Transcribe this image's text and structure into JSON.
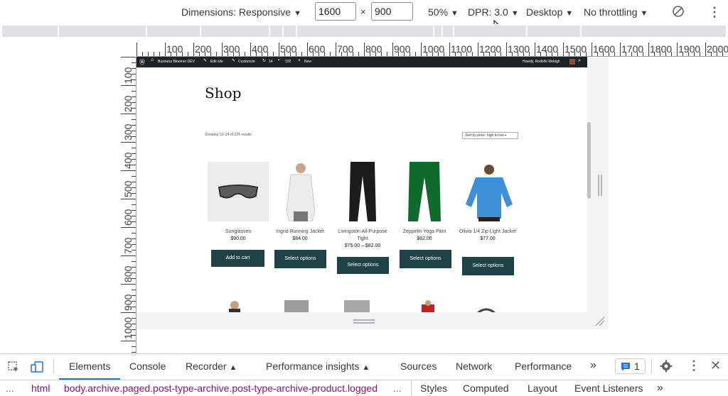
{
  "toolbar": {
    "dimensions_label": "Dimensions: Responsive",
    "width_value": "1600",
    "times": "×",
    "height_value": "900",
    "zoom": "50%",
    "dpr": "DPR: 3.0",
    "device_type": "Desktop",
    "throttling": "No throttling",
    "caret": "▼",
    "more": "⋮"
  },
  "ruler": {
    "h_labels": [
      "100",
      "200",
      "300",
      "400",
      "500",
      "600",
      "700",
      "800",
      "900",
      "1000",
      "1100",
      "1200",
      "1300",
      "1400",
      "1500",
      "1600",
      "1700",
      "1800",
      "1900",
      "2000"
    ],
    "v_labels": [
      "100",
      "200",
      "300",
      "400",
      "500",
      "600",
      "700",
      "800",
      "900",
      "1000"
    ]
  },
  "admin_bar": {
    "site_name": "Business Bloomer DEV",
    "edit_site": "Edit site",
    "customize": "Customize",
    "updates": "14",
    "comments": "102",
    "new": "New",
    "greeting": "Howdy, Rodolfo Melogli"
  },
  "shop": {
    "title": "Shop",
    "results": "Showing 13–24 of 224 results",
    "sort": "Sort by price: high to low"
  },
  "products": [
    {
      "name": "Sunglasses",
      "price": "$90.00",
      "button": "Add to cart"
    },
    {
      "name": "Ingrid Running Jacket",
      "price": "$84.00",
      "button": "Select options"
    },
    {
      "name": "Livingston All-Purpose Tight",
      "price": "$75.00 – $82.00",
      "button": "Select options"
    },
    {
      "name": "Zeppelin Yoga Pant",
      "price": "$82.00",
      "button": "Select options"
    },
    {
      "name": "Olivia 1/4 Zip Light Jacket",
      "price": "$77.00",
      "button": "Select options"
    }
  ],
  "devtools": {
    "tabs": [
      "Elements",
      "Console",
      "Recorder",
      "Performance insights",
      "Sources",
      "Network",
      "Performance"
    ],
    "more_tabs": "»",
    "issues_count": "1",
    "breadcrumb_html": "html",
    "breadcrumb_body": "body.archive.paged.post-type-archive.post-type-archive-product.logged",
    "ellipsis": "...",
    "side_tabs": [
      "Styles",
      "Computed",
      "Layout",
      "Event Listeners"
    ]
  },
  "colors": {
    "button_bg": "#1e4245",
    "admin_bar": "#1d2327",
    "active_tab": "#1a73e8"
  }
}
